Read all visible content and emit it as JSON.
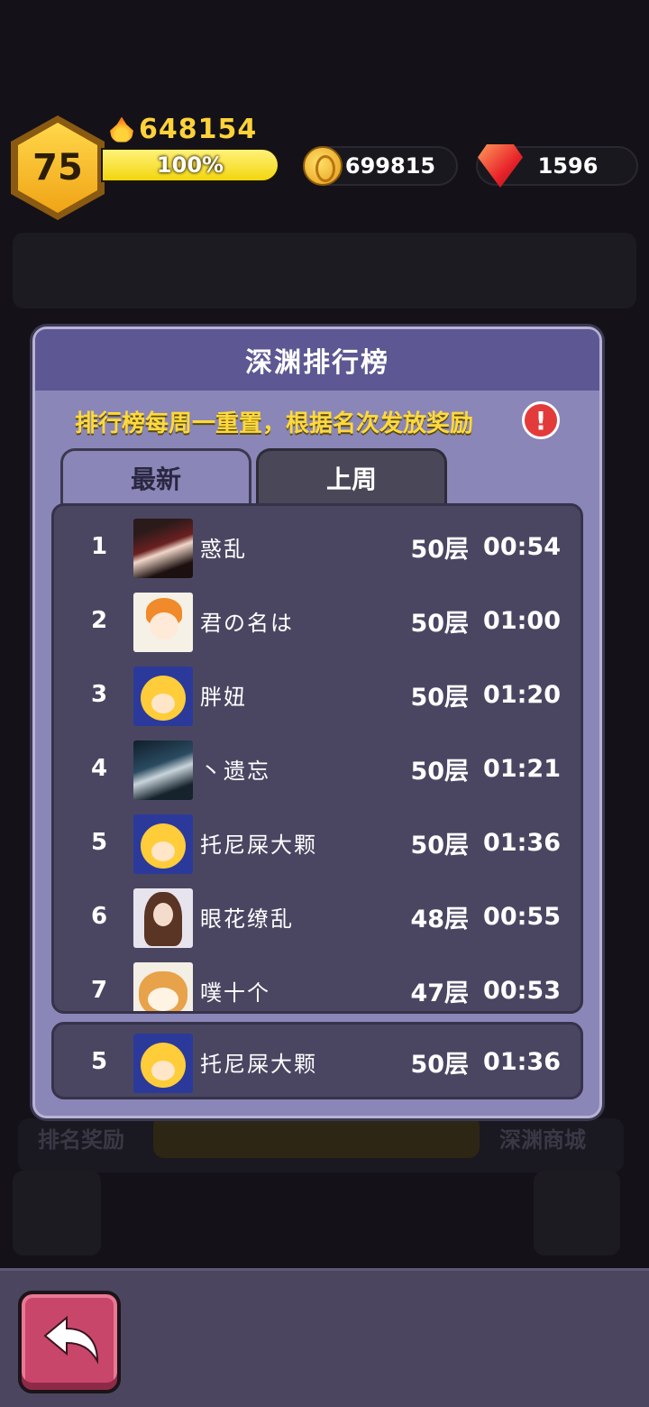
{
  "hud": {
    "level": "75",
    "power": "648154",
    "exp_percent_label": "100%",
    "exp_fraction": 1.0,
    "coins": "699815",
    "gems": "1596"
  },
  "panel": {
    "title": "深渊排行榜",
    "notice": "排行榜每周一重置，根据名次发放奖励",
    "info_symbol": "!",
    "tabs": {
      "latest": "最新",
      "last_week": "上周"
    }
  },
  "leaderboard": [
    {
      "rank": "1",
      "name": "惑乱",
      "floor": "50层",
      "time": "00:54",
      "avatar": "fox-girl-avatar"
    },
    {
      "rank": "2",
      "name": "君の名は",
      "floor": "50层",
      "time": "01:00",
      "avatar": "orange-hair-boy-avatar"
    },
    {
      "rank": "3",
      "name": "胖妞",
      "floor": "50层",
      "time": "01:20",
      "avatar": "blonde-chibi-avatar"
    },
    {
      "rank": "4",
      "name": "丶遗忘",
      "floor": "50层",
      "time": "01:21",
      "avatar": "silver-hair-avatar"
    },
    {
      "rank": "5",
      "name": "托尼屎大颗",
      "floor": "50层",
      "time": "01:36",
      "avatar": "blonde-chibi-avatar"
    },
    {
      "rank": "6",
      "name": "眼花缭乱",
      "floor": "48层",
      "time": "00:55",
      "avatar": "brown-hair-girl-avatar"
    },
    {
      "rank": "7",
      "name": "噗十个",
      "floor": "47层",
      "time": "00:53",
      "avatar": "shiba-dog-avatar"
    }
  ],
  "self_entry": {
    "rank": "5",
    "name": "托尼屎大颗",
    "floor": "50层",
    "time": "01:36",
    "avatar": "blonde-chibi-avatar"
  },
  "background": {
    "left_label": "排名奖励",
    "right_label": "深渊商城"
  },
  "colors": {
    "panel": "#8a86b8",
    "header": "#5d5893",
    "notice": "#ffd93c",
    "back_button": "#c8466a"
  }
}
